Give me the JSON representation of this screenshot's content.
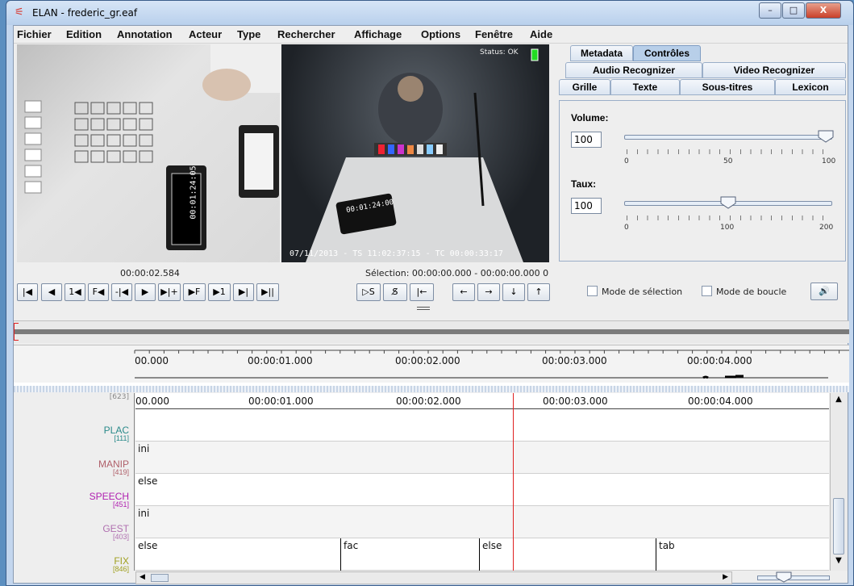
{
  "window": {
    "title": "ELAN - frederic_gr.eaf",
    "minimize": "–",
    "maximize": "□",
    "close": "X"
  },
  "menu": [
    "Fichier",
    "Edition",
    "Annotation",
    "Acteur",
    "Type",
    "Rechercher",
    "Affichage",
    "Options",
    "Fenêtre",
    "Aide"
  ],
  "video": {
    "right_overlay": "07/11/2013 - TS 11:02:37:15 - TC 00:00:33:17",
    "left_timer": "00:01:24:05",
    "right_timer": "00:01:24:00",
    "status": "Status: OK"
  },
  "tabs": {
    "row1": [
      "Metadata",
      "Contrôles"
    ],
    "row2": [
      "Audio Recognizer",
      "Video Recognizer"
    ],
    "row3": [
      "Grille",
      "Texte",
      "Sous-titres",
      "Lexicon"
    ]
  },
  "controls": {
    "volume_label": "Volume:",
    "volume_value": "100",
    "volume_fraction": 0.97,
    "volume_ticks": [
      "0",
      "50",
      "100"
    ],
    "rate_label": "Taux:",
    "rate_value": "100",
    "rate_fraction": 0.5,
    "rate_ticks": [
      "0",
      "100",
      "200"
    ]
  },
  "time": {
    "current": "00:00:02.584",
    "selection": "Sélection: 00:00:00.000 - 00:00:00.000  0"
  },
  "buttons": [
    "|◀",
    "◀",
    "1◀",
    "F◀",
    "-|◀",
    "▶",
    "▶|+",
    "▶F",
    "▶1",
    "▶|",
    "▶||",
    "▷S",
    "S̸",
    "|←",
    "←",
    "→",
    "↓",
    "↑"
  ],
  "checkboxes": {
    "selection": "Mode de sélection",
    "loop": "Mode de boucle"
  },
  "ruler": [
    "00.000",
    "00:00:01.000",
    "00:00:02.000",
    "00:00:03.000",
    "00:00:04.000"
  ],
  "tiers": [
    {
      "name": "PLAC",
      "count": "[111]",
      "color": "#2a8a8a",
      "annotations": []
    },
    {
      "name": "MANIP",
      "count": "[419]",
      "color": "#b0606a",
      "annotations": [
        {
          "text": "ini",
          "start": 0
        }
      ]
    },
    {
      "name": "SPEECH",
      "count": "[451]",
      "color": "#b020b0",
      "annotations": [
        {
          "text": "else",
          "start": 0
        }
      ]
    },
    {
      "name": "GEST",
      "count": "[403]",
      "color": "#b070b0",
      "annotations": [
        {
          "text": "ini",
          "start": 0
        }
      ]
    },
    {
      "name": "FIX",
      "count": "[846]",
      "color": "#a0a020",
      "annotations": [
        {
          "text": "else",
          "start": 0
        },
        {
          "text": "fac",
          "start": 1.4
        },
        {
          "text": "else",
          "start": 2.35
        },
        {
          "text": "tab",
          "start": 3.55
        }
      ]
    }
  ],
  "top_count": "[623]",
  "colors": {
    "accent": "#5c8fc0",
    "cursor": "#e02020"
  }
}
